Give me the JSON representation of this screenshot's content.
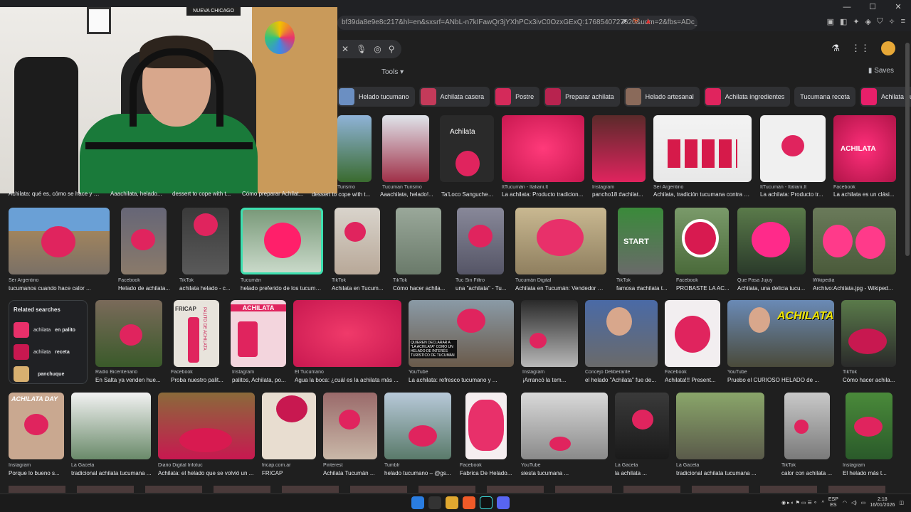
{
  "browser": {
    "address": "bf39da8e9e8c217&hl=en&sxsrf=ANbL-n7kIFawQr3jYXhPCx3ivC0OzxGExQ:1768540727620&udm=2&fbs=ADc_l-aN0C...",
    "window_controls": [
      "—",
      "☐",
      "✕"
    ]
  },
  "search": {
    "tools_label": "Tools",
    "saves_label": "Saves"
  },
  "chips": [
    {
      "label": "Helado tucumano",
      "color": "#6b8fc2"
    },
    {
      "label": "Achilata casera",
      "color": "#c43a5a"
    },
    {
      "label": "Postre",
      "color": "#d42a5a"
    },
    {
      "label": "Preparar achilata",
      "color": "#b8234f"
    },
    {
      "label": "Helado artesanal",
      "color": "#8a6a5a"
    },
    {
      "label": "Achilata ingredientes",
      "color": "#e0245e"
    },
    {
      "label": "Tucumana receta",
      "color": ""
    },
    {
      "label": "Achilata fruta",
      "color": "#e81f6a"
    }
  ],
  "webcam": {
    "sign_text": "NUEVA CHICAGO"
  },
  "row1": [
    {
      "src": "Turismo",
      "title": "dessert to cope with t..."
    },
    {
      "src": "Tucuman Turismo",
      "title": "Aaachilata, helado!..."
    },
    {
      "src": "",
      "title": "Ta'Loco Sanguchero..."
    },
    {
      "src": "ItTucumán - Italiani.It",
      "title": "La achilata: Producto tradicion..."
    },
    {
      "src": "Instagram",
      "title": "pancho18 #achilat..."
    },
    {
      "src": "Ser Argentino",
      "title": "Achilata, tradición tucumana contra el ..."
    },
    {
      "src": "ItTucumán - Italiani.It",
      "title": "La achilata: Producto tr..."
    },
    {
      "src": "Facebook",
      "title": "La achilata es un clási..."
    }
  ],
  "row1_partial": [
    "Achilata: qué es, cómo se hace y q...",
    "Aaachilata, helado...",
    "dessert to cope with t...",
    "Cómo preparar Achilat..."
  ],
  "row2": [
    {
      "src": "Ser Argentino",
      "title": "tucumanos cuando hace calor ..."
    },
    {
      "src": "Facebook",
      "title": "Helado de achilata..."
    },
    {
      "src": "TikTok",
      "title": "achilata helado - c..."
    },
    {
      "src": "Tucumán",
      "title": "helado preferido de los tucuma..."
    },
    {
      "src": "TikTok",
      "title": "Achilata en Tucum..."
    },
    {
      "src": "TikTok",
      "title": "Cómo hacer achila..."
    },
    {
      "src": "Tuc Sin Filtro",
      "title": "una \"achilata\" - Tu..."
    },
    {
      "src": "Tucumán Digital",
      "title": "Achilata en Tucumán: Vendedor di..."
    },
    {
      "src": "TikTok",
      "title": "famosa #achilata t..."
    },
    {
      "src": "Facebook",
      "title": "PROBASTE LA AC..."
    },
    {
      "src": "Que Pasa Jujuy",
      "title": "Achilata, una delicia tucu..."
    },
    {
      "src": "Wikipedia",
      "title": "Archivo:Achilata.jpg - Wikiped..."
    }
  ],
  "related": {
    "heading": "Related searches",
    "items": [
      {
        "pre": "achilata ",
        "bold": "en palito"
      },
      {
        "pre": "achilata ",
        "bold": "receta"
      },
      {
        "pre": "",
        "bold": "panchuque"
      }
    ]
  },
  "row3": [
    {
      "src": "Radio Bicentenario",
      "title": "En Salta ya venden hue..."
    },
    {
      "src": "Facebook",
      "title": "Proba nuestro palit..."
    },
    {
      "src": "Instagram",
      "title": "palitos, Achilata, po..."
    },
    {
      "src": "El Tucumano",
      "title": "Agua la boca: ¿cuál es la achilata más ..."
    },
    {
      "src": "YouTube",
      "title": "La achilata: refresco tucumano y ..."
    },
    {
      "src": "Instagram",
      "title": "¡Arrancó la tem..."
    },
    {
      "src": "Concejo Deliberante",
      "title": "el helado \"Achilata\" fue de..."
    },
    {
      "src": "Facebook",
      "title": "Achilata!!! Present..."
    },
    {
      "src": "YouTube",
      "title": "Pruebo el CURIOSO HELADO de ..."
    },
    {
      "src": "TikTok",
      "title": "Cómo hacer achila..."
    }
  ],
  "row3_texts": {
    "fricap": "FRICAP",
    "achilata_label": "ACHILATA",
    "palito": "PALITO DE ACHILATA",
    "quieren": "QUIEREN DECLARAR A \"LA ACHILATA\" COMO UN HELADO DE INTERÉS TURÍSTICO DE TUCUMÁN",
    "achilata_big": "ACHILATA"
  },
  "row4": [
    {
      "src": "Instagram",
      "title": "Porque lo bueno s..."
    },
    {
      "src": "La Gaceta",
      "title": "tradicional achilata tucumana ..."
    },
    {
      "src": "Diario Digital Infotuc",
      "title": "Achilata: el helado que se volvió un ..."
    },
    {
      "src": "fricap.com.ar",
      "title": "FRICAP"
    },
    {
      "src": "Pinterest",
      "title": "Achilata Tucumán ..."
    },
    {
      "src": "Tumblr",
      "title": "helado tucumano – @gs..."
    },
    {
      "src": "Facebook",
      "title": "Fabrica De Helado..."
    },
    {
      "src": "YouTube",
      "title": "siesta tucumana ..."
    },
    {
      "src": "La Gaceta",
      "title": "la achilata ..."
    },
    {
      "src": "La Gaceta",
      "title": "tradicional achilata tucumana ..."
    },
    {
      "src": "TikTok",
      "title": "calor con achilata ..."
    },
    {
      "src": "Instagram",
      "title": "El helado más t..."
    }
  ],
  "row4_texts": {
    "achilata_day": "ACHILATA DAY"
  },
  "row1_texts": {
    "achilata_title": "Achilata",
    "achilata_caps": "ACHILATA",
    "start": "START"
  },
  "taskbar": {
    "lang_top": "ESP",
    "lang_bottom": "ES",
    "time": "2:18",
    "date": "16/01/2026"
  },
  "colors": {
    "accent_pink": "#e0245e",
    "bg": "#1f1f1f",
    "selected_border": "#3ee0b0"
  }
}
